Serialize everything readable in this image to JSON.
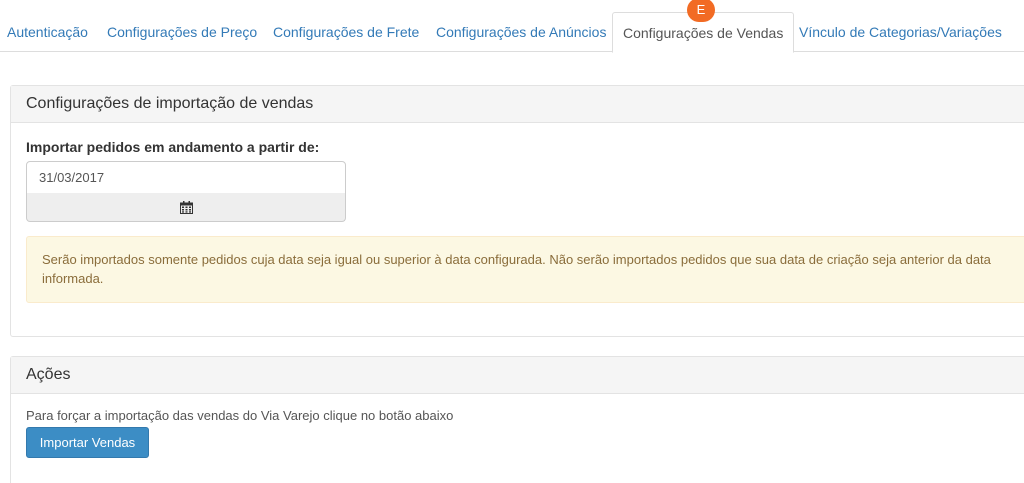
{
  "tabs": [
    {
      "label": "Autenticação"
    },
    {
      "label": "Configurações de Preço"
    },
    {
      "label": "Configurações de Frete"
    },
    {
      "label": "Configurações de Anúncios"
    },
    {
      "label": "Configurações de Vendas",
      "active": true,
      "badge": "E"
    },
    {
      "label": "Vínculo de Categorias/Variações"
    }
  ],
  "import_panel": {
    "title": "Configurações de importação de vendas",
    "field_label": "Importar pedidos em andamento a partir de:",
    "date_value": "31/03/2017",
    "calendar_icon": "calendar-icon",
    "alert_text": "Serão importados somente pedidos cuja data seja igual ou superior à data configurada. Não serão importados pedidos que sua data de criação seja anterior da data informada."
  },
  "actions_panel": {
    "title": "Ações",
    "description": "Para forçar a importação das vendas do Via Varejo clique no botão abaixo",
    "button_label": "Importar Vendas"
  },
  "colors": {
    "link": "#337ab7",
    "badge": "#f26b24",
    "primary_button": "#3c8dc5",
    "alert_bg": "#fcf8e3",
    "alert_text": "#8a6d3b"
  }
}
